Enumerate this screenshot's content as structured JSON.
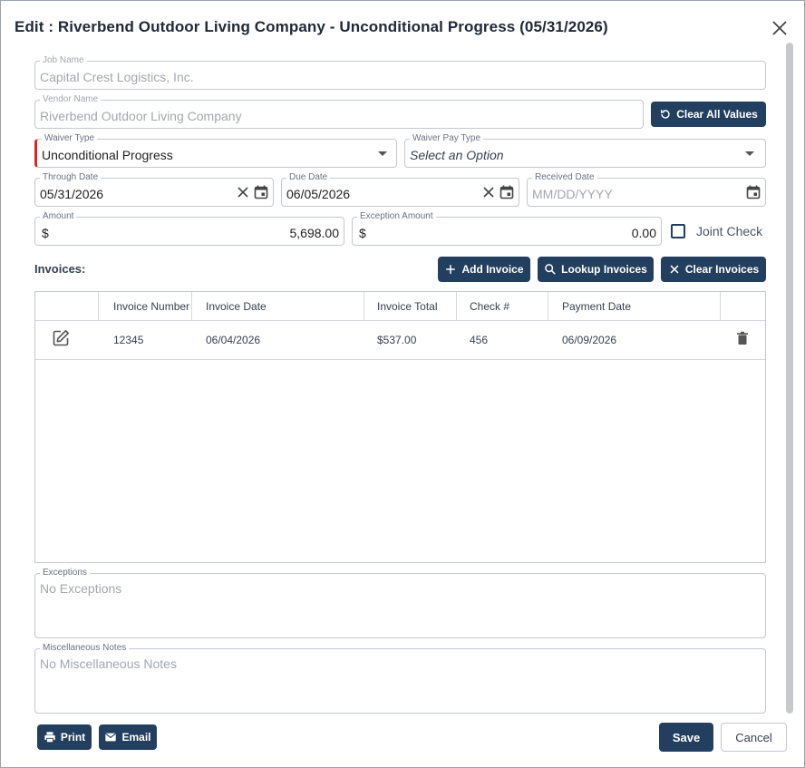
{
  "dialog": {
    "title": "Edit : Riverbend Outdoor Living Company - Unconditional Progress (05/31/2026)"
  },
  "fields": {
    "job_name": {
      "label": "Job Name",
      "value": "Capital Crest Logistics, Inc."
    },
    "vendor_name": {
      "label": "Vendor Name",
      "value": "Riverbend Outdoor Living Company"
    },
    "waiver_type": {
      "label": "Waiver Type",
      "value": "Unconditional Progress"
    },
    "waiver_pay_type": {
      "label": "Waiver Pay Type",
      "placeholder": "Select an Option"
    },
    "through_date": {
      "label": "Through Date",
      "value": "05/31/2026"
    },
    "due_date": {
      "label": "Due Date",
      "value": "06/05/2026"
    },
    "received_date": {
      "label": "Received Date",
      "placeholder": "MM/DD/YYYY"
    },
    "amount": {
      "label": "Amount",
      "prefix": "$",
      "value": "5,698.00"
    },
    "exception_amount": {
      "label": "Exception Amount",
      "prefix": "$",
      "value": "0.00"
    },
    "joint_check": {
      "label": "Joint Check",
      "checked": false
    }
  },
  "buttons": {
    "clear_all_values": "Clear All Values",
    "add_invoice": "Add Invoice",
    "lookup_invoices": "Lookup Invoices",
    "clear_invoices": "Clear Invoices",
    "print": "Print",
    "email": "Email",
    "save": "Save",
    "cancel": "Cancel"
  },
  "invoices": {
    "section_label": "Invoices:",
    "columns": [
      "Invoice Number",
      "Invoice Date",
      "Invoice Total",
      "Check #",
      "Payment Date"
    ],
    "rows": [
      {
        "invoice_number": "12345",
        "invoice_date": "06/04/2026",
        "invoice_total": "$537.00",
        "check_number": "456",
        "payment_date": "06/09/2026"
      }
    ]
  },
  "exceptions": {
    "label": "Exceptions",
    "placeholder": "No Exceptions"
  },
  "misc_notes": {
    "label": "Miscellaneous Notes",
    "placeholder": "No Miscellaneous Notes"
  },
  "colors": {
    "primary": "#233f5f",
    "required_marker": "#dc2626",
    "border": "#c4c8cf"
  },
  "icons": {
    "close": "close-icon",
    "refresh": "refresh-icon",
    "calendar": "calendar-icon",
    "clear": "clear-x-icon",
    "plus": "plus-icon",
    "search": "search-icon",
    "edit": "edit-icon",
    "trash": "trash-icon",
    "printer": "printer-icon",
    "mail": "mail-icon"
  }
}
